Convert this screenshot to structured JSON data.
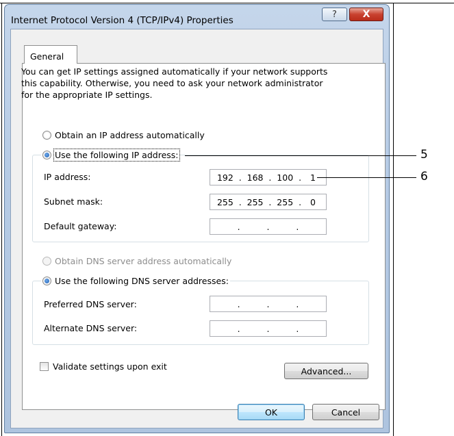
{
  "window": {
    "title": "Internet Protocol Version 4 (TCP/IPv4) Properties",
    "help_label": "?",
    "close_label": "X"
  },
  "tabs": [
    {
      "label": "General",
      "active": true
    }
  ],
  "intro_text": "You can get IP settings assigned automatically if your network supports\nthis capability. Otherwise, you need to ask your network administrator\nfor the appropriate IP settings.",
  "ip_section": {
    "auto_label": "Obtain an IP address automatically",
    "manual_label": "Use the following IP address:",
    "selected": "manual",
    "fields": [
      {
        "label": "IP address:",
        "octets": [
          "192",
          "168",
          "100",
          "1"
        ]
      },
      {
        "label": "Subnet mask:",
        "octets": [
          "255",
          "255",
          "255",
          "0"
        ]
      },
      {
        "label": "Default gateway:",
        "octets": [
          "",
          "",
          "",
          ""
        ]
      }
    ]
  },
  "dns_section": {
    "auto_label": "Obtain DNS server address automatically",
    "manual_label": "Use the following DNS server addresses:",
    "selected": "manual",
    "fields": [
      {
        "label": "Preferred DNS server:",
        "octets": [
          "",
          "",
          "",
          ""
        ]
      },
      {
        "label": "Alternate DNS server:",
        "octets": [
          "",
          "",
          "",
          ""
        ]
      }
    ]
  },
  "validate_label": "Validate settings upon exit",
  "validate_checked": false,
  "buttons": {
    "advanced": "Advanced...",
    "ok": "OK",
    "cancel": "Cancel"
  },
  "callouts": [
    "5",
    "6"
  ],
  "colors": {
    "accent": "#1d5fb4",
    "close": "#c9412f",
    "title_bar": "#b6cbe5"
  }
}
